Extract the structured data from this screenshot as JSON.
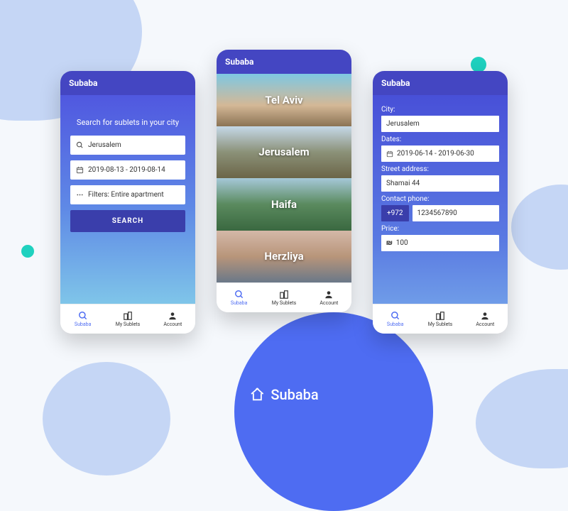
{
  "brand": "Subaba",
  "screen1": {
    "header": "Subaba",
    "title": "Search for sublets in your city",
    "city": "Jerusalem",
    "dates": "2019-08-13 - 2019-08-14",
    "filters": "Filters: Entire apartment",
    "button": "SEARCH"
  },
  "screen2": {
    "header": "Subaba",
    "cities": [
      "Tel Aviv",
      "Jerusalem",
      "Haifa",
      "Herzliya"
    ]
  },
  "screen3": {
    "header": "Subaba",
    "city_label": "City:",
    "city": "Jerusalem",
    "dates_label": "Dates:",
    "dates": "2019-06-14 - 2019-06-30",
    "street_label": "Street address:",
    "street": "Shamai 44",
    "phone_label": "Contact phone:",
    "prefix": "+972",
    "phone": "1234567890",
    "price_label": "Price:",
    "price": "100"
  },
  "tabs": {
    "t1": "Subaba",
    "t2": "My Sublets",
    "t3": "Account"
  }
}
